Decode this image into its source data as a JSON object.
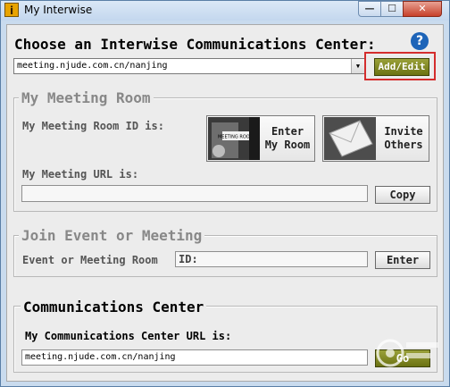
{
  "window": {
    "title": "My Interwise",
    "min": "—",
    "max": "☐",
    "close": "✕"
  },
  "header": {
    "heading": "Choose an Interwise Communications Center:",
    "help": "?"
  },
  "center_select": {
    "value": "meeting.njude.com.cn/nanjing",
    "arrow": "▼"
  },
  "add_edit_button": "Add/Edit",
  "meeting_room": {
    "legend": "My Meeting Room",
    "id_label": "My Meeting Room ID is:",
    "enter_line1": "Enter",
    "enter_line2": "My Room",
    "door_sign": "MEETING ROOM",
    "invite_line1": "Invite",
    "invite_line2": "Others",
    "url_label": "My Meeting URL is:",
    "url_value": "",
    "copy_button": "Copy"
  },
  "join": {
    "legend": "Join Event or Meeting",
    "room_label": "Event or Meeting Room",
    "id_value": "ID:",
    "enter_button": "Enter"
  },
  "center": {
    "legend": "Communications Center",
    "url_label": "My Communications Center URL is:",
    "url_value": "meeting.njude.com.cn/nanjing",
    "go_button": "Go"
  },
  "colors": {
    "accent_olive": "#7d8420",
    "highlight_red": "#d42d2d",
    "help_blue": "#1d64b8"
  }
}
